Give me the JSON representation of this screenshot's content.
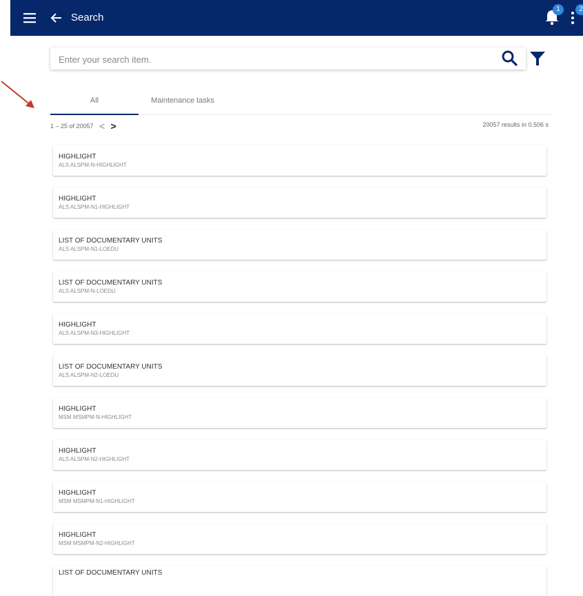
{
  "header": {
    "title": "Search",
    "notifications_badge": "1",
    "more_badge": "2",
    "bar_color": "#06286b"
  },
  "search": {
    "placeholder": "Enter your search item.",
    "value": ""
  },
  "tabs": [
    {
      "label": "All",
      "active": true
    },
    {
      "label": "Maintenance tasks",
      "active": false
    }
  ],
  "pagination": {
    "range_text": "1 – 25 of 20057",
    "prev": "<",
    "next": ">"
  },
  "results_info": "20057 results in 0.506 s",
  "results": [
    {
      "title": "HIGHLIGHT",
      "subtitle": "ALS ALSPM-N-HIGHLIGHT"
    },
    {
      "title": "HIGHLIGHT",
      "subtitle": "ALS ALSPM-N1-HIGHLIGHT"
    },
    {
      "title": "LIST OF DOCUMENTARY UNITS",
      "subtitle": "ALS ALSPM-N1-LOEDU"
    },
    {
      "title": "LIST OF DOCUMENTARY UNITS",
      "subtitle": "ALS ALSPM-N-LOEDU"
    },
    {
      "title": "HIGHLIGHT",
      "subtitle": "ALS ALSPM-N3-HIGHLIGHT"
    },
    {
      "title": "LIST OF DOCUMENTARY UNITS",
      "subtitle": "ALS ALSPM-N2-LOEDU"
    },
    {
      "title": "HIGHLIGHT",
      "subtitle": "MSM MSMPM-N-HIGHLIGHT"
    },
    {
      "title": "HIGHLIGHT",
      "subtitle": "ALS ALSPM-N2-HIGHLIGHT"
    },
    {
      "title": "HIGHLIGHT",
      "subtitle": "MSM MSMPM-N1-HIGHLIGHT"
    },
    {
      "title": "HIGHLIGHT",
      "subtitle": "MSM MSMPM-N2-HIGHLIGHT"
    },
    {
      "title": "LIST OF DOCUMENTARY UNITS",
      "subtitle": ""
    }
  ]
}
